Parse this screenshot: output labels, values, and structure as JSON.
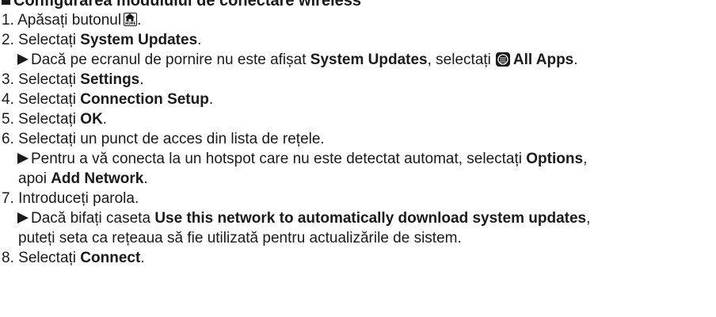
{
  "section": {
    "title": "Configurarea modulului de conectare wireless"
  },
  "steps": [
    {
      "num": "1.",
      "pre": "Apăsați butonul",
      "post": "."
    },
    {
      "num": "2.",
      "pre": "Selectați ",
      "bold": "System Updates",
      "post": "."
    },
    {
      "num": "3.",
      "pre": "Selectați ",
      "bold": "Settings",
      "post": "."
    },
    {
      "num": "4.",
      "pre": "Selectați ",
      "bold": "Connection Setup",
      "post": "."
    },
    {
      "num": "5.",
      "pre": "Selectați ",
      "bold": "OK",
      "post": "."
    },
    {
      "num": "6.",
      "pre": "Selectați un punct de acces din lista de rețele."
    },
    {
      "num": "7.",
      "pre": "Introduceți parola."
    },
    {
      "num": "8.",
      "pre": "Selectați ",
      "bold": "Connect",
      "post": "."
    }
  ],
  "notes": {
    "step2": {
      "pre": "Dacă pe ecranul de pornire nu este afișat ",
      "bold1": "System Updates",
      "mid": ", selectați",
      "bold2": "All Apps",
      "post": "."
    },
    "step6": {
      "pre": "Pentru a vă conecta la un hotspot care nu este detectat automat, selectați ",
      "bold1": "Options",
      "post1": ",",
      "cont_pre": "apoi ",
      "bold2": "Add Network",
      "post2": "."
    },
    "step7": {
      "pre": "Dacă bifați caseta ",
      "bold1": "Use this network to automatically download system updates",
      "post1": ",",
      "cont": "puteți seta ca rețeaua să fie utilizată pentru actualizările de sistem."
    }
  },
  "icons": {
    "home_label": "HOME",
    "home_icon": "home-button-icon",
    "apps_icon": "all-apps-icon",
    "arrow_icon": "triangle-bullet-icon"
  }
}
